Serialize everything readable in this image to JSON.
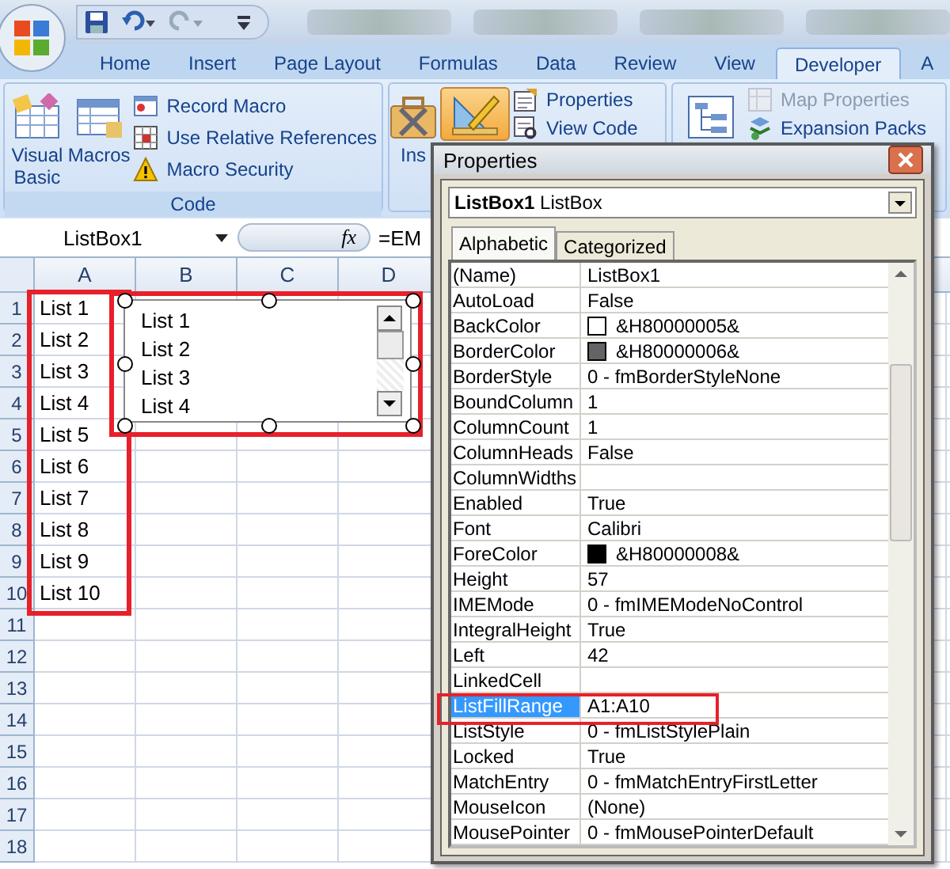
{
  "ribbon_tabs": [
    {
      "label": "Home",
      "selected": false
    },
    {
      "label": "Insert",
      "selected": false
    },
    {
      "label": "Page Layout",
      "selected": false
    },
    {
      "label": "Formulas",
      "selected": false
    },
    {
      "label": "Data",
      "selected": false
    },
    {
      "label": "Review",
      "selected": false
    },
    {
      "label": "View",
      "selected": false
    },
    {
      "label": "Developer",
      "selected": true
    },
    {
      "label": "A",
      "selected": false
    }
  ],
  "code_group": {
    "label": "Code",
    "large_buttons": [
      "Visual Basic",
      "Macros"
    ],
    "small_buttons": [
      "Record Macro",
      "Use Relative References",
      "Macro Security"
    ]
  },
  "controls_group": {
    "insert_label": "Ins",
    "design_mode_on": true,
    "small_buttons": [
      "Properties",
      "View Code"
    ]
  },
  "xml_group": {
    "small_buttons": [
      {
        "label": "Map Properties",
        "disabled": true
      },
      {
        "label": "Expansion Packs",
        "disabled": false
      }
    ]
  },
  "formula_bar": {
    "name_box": "ListBox1",
    "function_label": "fx",
    "formula": "=EM"
  },
  "sheet": {
    "columns": [
      "A",
      "B",
      "C",
      "D"
    ],
    "rows": [
      {
        "number": "1",
        "cell_a": "List 1"
      },
      {
        "number": "2",
        "cell_a": "List 2"
      },
      {
        "number": "3",
        "cell_a": "List 3"
      },
      {
        "number": "4",
        "cell_a": "List 4"
      },
      {
        "number": "5",
        "cell_a": "List 5"
      },
      {
        "number": "6",
        "cell_a": "List 6"
      },
      {
        "number": "7",
        "cell_a": "List 7"
      },
      {
        "number": "8",
        "cell_a": "List 8"
      },
      {
        "number": "9",
        "cell_a": "List 9"
      },
      {
        "number": "10",
        "cell_a": "List 10"
      },
      {
        "number": "11"
      },
      {
        "number": "12"
      },
      {
        "number": "13"
      },
      {
        "number": "14"
      },
      {
        "number": "15"
      },
      {
        "number": "16"
      },
      {
        "number": "17"
      },
      {
        "number": "18"
      }
    ]
  },
  "listbox_control": {
    "items": [
      "List 1",
      "List 2",
      "List 3",
      "List 4"
    ]
  },
  "properties_window": {
    "title": "Properties",
    "object_name": "ListBox1",
    "object_type": "ListBox",
    "tabs": [
      {
        "label": "Alphabetic",
        "selected": true
      },
      {
        "label": "Categorized",
        "selected": false
      }
    ],
    "properties": [
      {
        "name": "(Name)",
        "value": "ListBox1",
        "selected": false
      },
      {
        "name": "AutoLoad",
        "value": "False",
        "selected": false
      },
      {
        "name": "BackColor",
        "value": "&H80000005&",
        "selected": false,
        "color": "#ffffff"
      },
      {
        "name": "BorderColor",
        "value": "&H80000006&",
        "selected": false,
        "color": "#646464"
      },
      {
        "name": "BorderStyle",
        "value": "0 - fmBorderStyleNone",
        "selected": false
      },
      {
        "name": "BoundColumn",
        "value": "1",
        "selected": false
      },
      {
        "name": "ColumnCount",
        "value": "1",
        "selected": false
      },
      {
        "name": "ColumnHeads",
        "value": "False",
        "selected": false
      },
      {
        "name": "ColumnWidths",
        "selected": false
      },
      {
        "name": "Enabled",
        "value": "True",
        "selected": false
      },
      {
        "name": "Font",
        "value": "Calibri",
        "selected": false
      },
      {
        "name": "ForeColor",
        "value": "&H80000008&",
        "selected": false,
        "color": "#000000"
      },
      {
        "name": "Height",
        "value": "57",
        "selected": false
      },
      {
        "name": "IMEMode",
        "value": "0 - fmIMEModeNoControl",
        "selected": false
      },
      {
        "name": "IntegralHeight",
        "value": "True",
        "selected": false
      },
      {
        "name": "Left",
        "value": "42",
        "selected": false
      },
      {
        "name": "LinkedCell",
        "selected": false
      },
      {
        "name": "ListFillRange",
        "value": "A1:A10",
        "selected": true
      },
      {
        "name": "ListStyle",
        "value": "0 - fmListStylePlain",
        "selected": false
      },
      {
        "name": "Locked",
        "value": "True",
        "selected": false
      },
      {
        "name": "MatchEntry",
        "value": "0 - fmMatchEntryFirstLetter",
        "selected": false
      },
      {
        "name": "MouseIcon",
        "value": "(None)",
        "selected": false
      },
      {
        "name": "MousePointer",
        "value": "0 - fmMousePointerDefault",
        "selected": false
      }
    ]
  }
}
